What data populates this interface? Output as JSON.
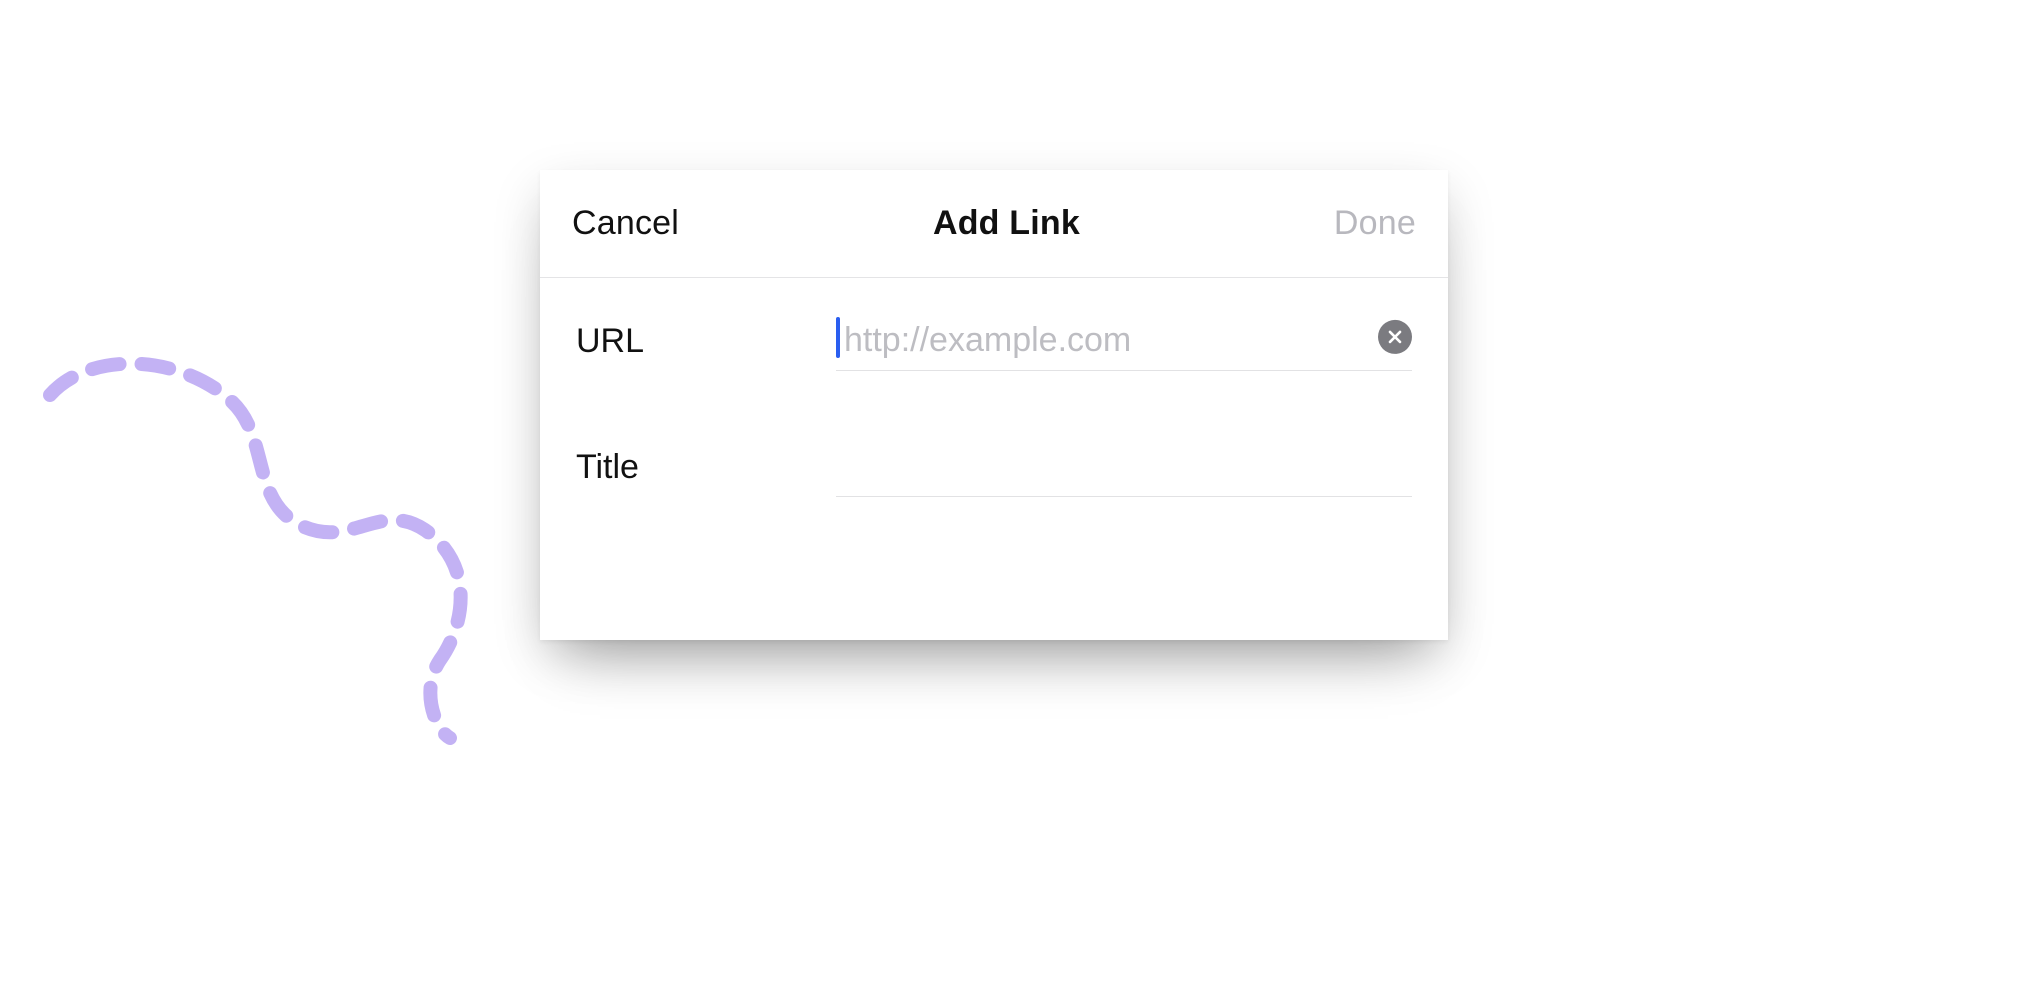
{
  "decoration": {
    "squiggle_color": "#c3b2f4",
    "squiggle_dash": "28 22"
  },
  "dialog": {
    "header": {
      "cancel_label": "Cancel",
      "title": "Add Link",
      "done_label": "Done"
    },
    "fields": {
      "url": {
        "label": "URL",
        "placeholder": "http://example.com",
        "value": "",
        "focused": true,
        "clear_icon": "close-circle-icon"
      },
      "title": {
        "label": "Title",
        "placeholder": "",
        "value": ""
      }
    }
  }
}
